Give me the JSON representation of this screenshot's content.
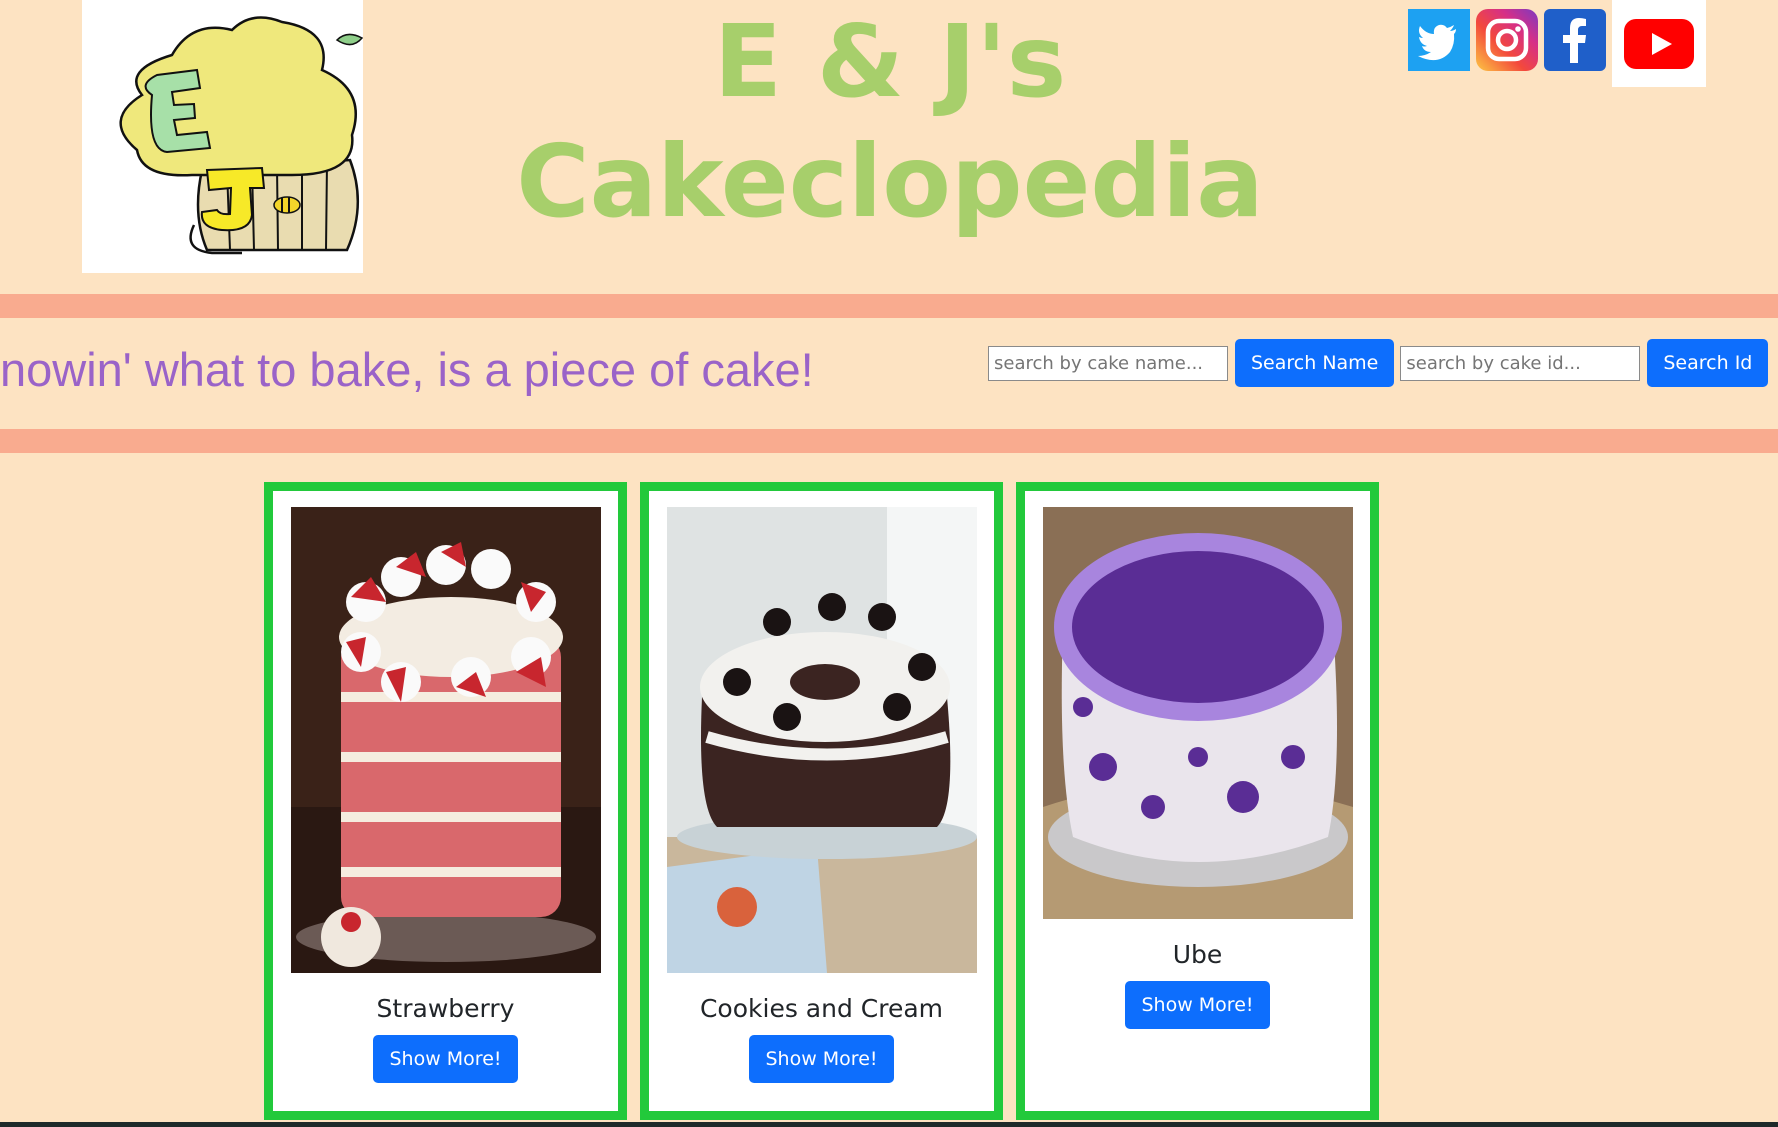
{
  "header": {
    "title_line1": "E & J's",
    "title_line2": "Cakeclopedia",
    "logo_icon": "cupcake-logo-icon"
  },
  "social": [
    {
      "name": "twitter-icon",
      "color": "#1da1f2"
    },
    {
      "name": "instagram-icon",
      "color": "#e1306c"
    },
    {
      "name": "facebook-icon",
      "color": "#1877f2"
    },
    {
      "name": "youtube-icon",
      "color": "#ff0000"
    }
  ],
  "tagline": "nowin' what to bake, is a piece of cake!",
  "search": {
    "name_placeholder": "search by cake name...",
    "name_button": "Search Name",
    "id_placeholder": "search by cake id...",
    "id_button": "Search Id"
  },
  "cards": [
    {
      "title": "Strawberry",
      "button": "Show More!"
    },
    {
      "title": "Cookies and Cream",
      "button": "Show More!"
    },
    {
      "title": "Ube",
      "button": "Show More!"
    }
  ],
  "colors": {
    "background": "#fde3c2",
    "title": "#a7cf6b",
    "band": "#f9ab8f",
    "tagline": "#9a63c8",
    "button": "#0d6efd",
    "card_border": "#22c93b"
  }
}
